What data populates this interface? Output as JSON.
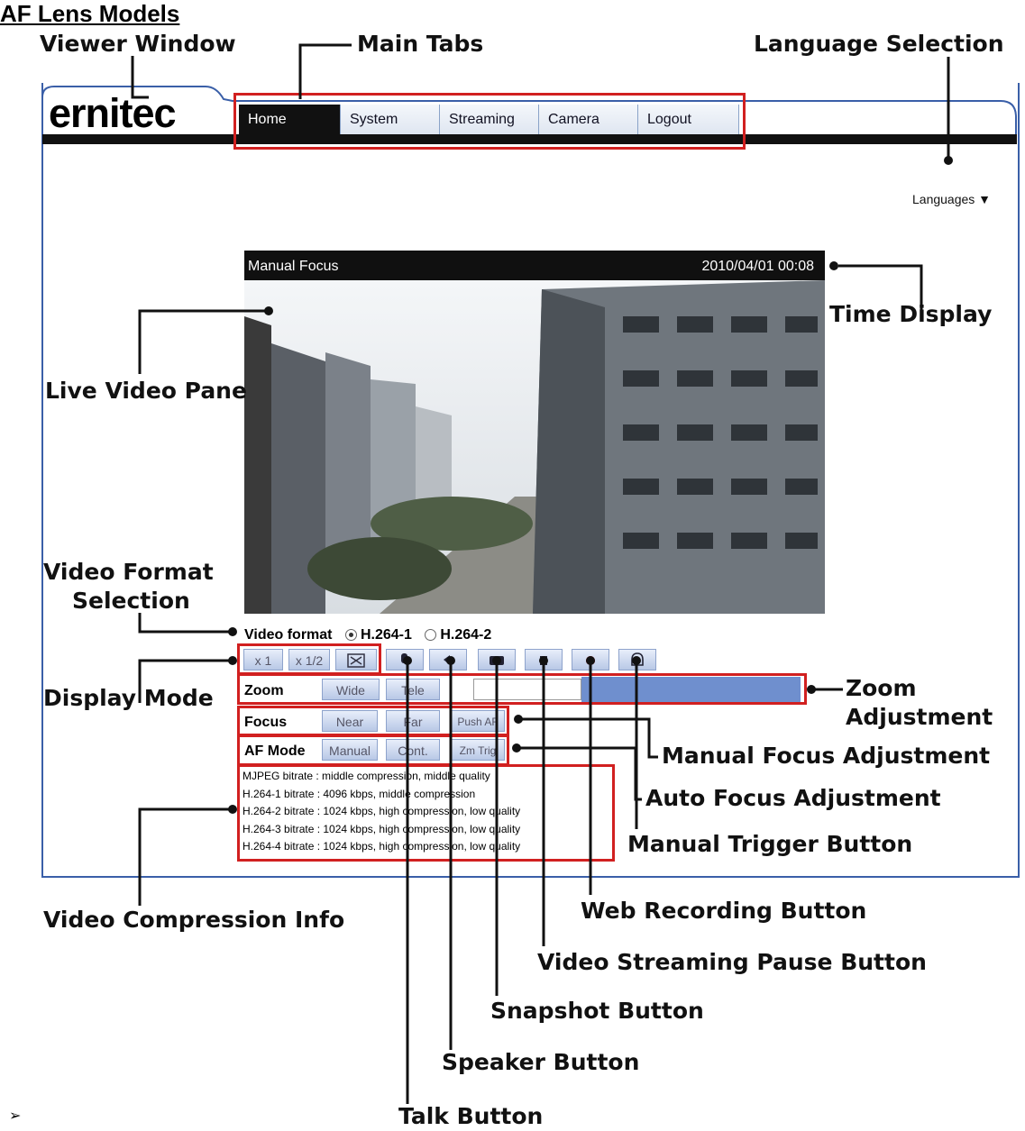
{
  "heading": "AF Lens Models",
  "callouts": {
    "viewer_window": "Viewer Window",
    "main_tabs": "Main Tabs",
    "language_selection": "Language Selection",
    "time_display": "Time Display",
    "live_video_pane": "Live Video Pane",
    "video_format_selection_1": "Video Format",
    "video_format_selection_2": "Selection",
    "display_mode": "Display Mode",
    "zoom_adjustment_1": "Zoom",
    "zoom_adjustment_2": "Adjustment",
    "manual_focus_adjustment": "Manual Focus Adjustment",
    "auto_focus_adjustment": "Auto Focus Adjustment",
    "manual_trigger_button": "Manual Trigger Button",
    "video_compression_info": "Video Compression Info",
    "web_recording_button": "Web Recording Button",
    "video_streaming_pause_button": "Video Streaming Pause Button",
    "snapshot_button": "Snapshot Button",
    "speaker_button": "Speaker Button",
    "talk_button": "Talk Button"
  },
  "ui": {
    "logo": "ernitec",
    "tabs": [
      "Home",
      "System",
      "Streaming",
      "Camera",
      "Logout"
    ],
    "active_tab": "Home",
    "languages": "Languages ▼",
    "video_title": "Manual Focus",
    "timestamp": "2010/04/01 00:08",
    "video_format_label": "Video format",
    "format_options": [
      "H.264-1",
      "H.264-2"
    ],
    "selected_format": "H.264-1",
    "display_buttons": [
      "x 1",
      "x 1/2"
    ],
    "zoom_label": "Zoom",
    "zoom_buttons": [
      "Wide",
      "Tele"
    ],
    "focus_label": "Focus",
    "focus_buttons": [
      "Near",
      "Far",
      "Push AF"
    ],
    "af_mode_label": "AF Mode",
    "af_mode_buttons": [
      "Manual",
      "Cont.",
      "Zm Trig"
    ],
    "compression_info": [
      "MJPEG bitrate : middle compression, middle quality",
      "H.264-1 bitrate : 4096 kbps, middle compression",
      "H.264-2 bitrate : 1024 kbps, high compression, low quality",
      "H.264-3 bitrate : 1024 kbps, high compression, low quality",
      "H.264-4 bitrate : 1024 kbps, high compression, low quality"
    ]
  },
  "bullet": "➢",
  "colors": {
    "annotation_red": "#d12020",
    "frame_blue": "#3a5fa8",
    "zoom_bar": "#6f8fce"
  }
}
